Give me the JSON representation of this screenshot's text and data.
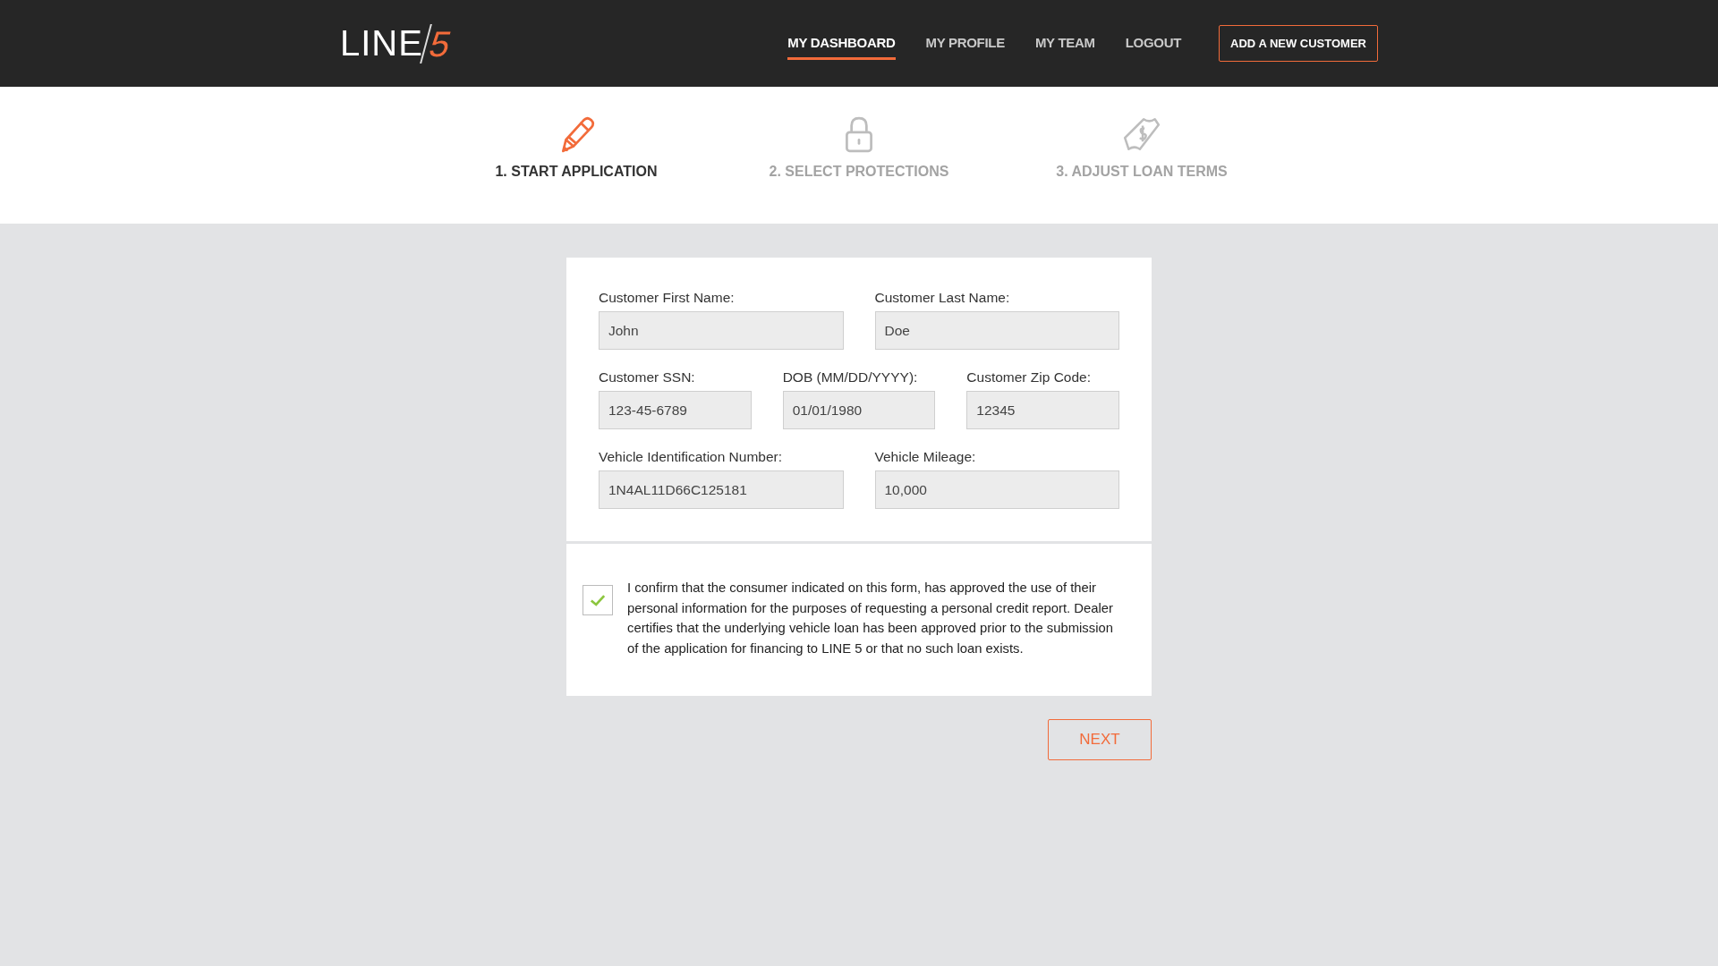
{
  "logo": {
    "text": "LINE",
    "mark": "5"
  },
  "nav": [
    {
      "label": "MY DASHBOARD",
      "selected": true
    },
    {
      "label": "MY PROFILE",
      "selected": false
    },
    {
      "label": "MY TEAM",
      "selected": false
    },
    {
      "label": "LOGOUT",
      "selected": false
    }
  ],
  "header_button": "ADD A NEW CUSTOMER",
  "steps": [
    {
      "kind": "pencil",
      "label": "1. START APPLICATION",
      "selected": true
    },
    {
      "kind": "lock",
      "label": "2. SELECT PROTECTIONS",
      "selected": false
    },
    {
      "kind": "money",
      "label": "3. ADJUST LOAN TERMS",
      "selected": false
    }
  ],
  "form_rows": [
    [
      {
        "label": "Customer First Name:",
        "value": "John"
      },
      {
        "label": "Customer Last Name:",
        "value": "Doe"
      }
    ],
    [
      {
        "label": "Customer SSN:",
        "value": "123-45-6789"
      },
      {
        "label": "DOB (MM/DD/YYYY):",
        "value": "01/01/1980"
      },
      {
        "label": "Customer Zip Code:",
        "value": "12345"
      }
    ],
    [
      {
        "label": "Vehicle Identification Number:",
        "value": "1N4AL11D66C125181"
      },
      {
        "label": "Vehicle Mileage:",
        "value": "10,000"
      }
    ]
  ],
  "consent": {
    "checked": true,
    "text": "I confirm that the consumer indicated on this form, has approved the use of their personal information for the purposes of requesting a personal credit report. Dealer certifies that the underlying vehicle loan has been approved prior to the submission of the application for financing to LINE 5 or that no such loan exists."
  },
  "next_button": "NEXT"
}
